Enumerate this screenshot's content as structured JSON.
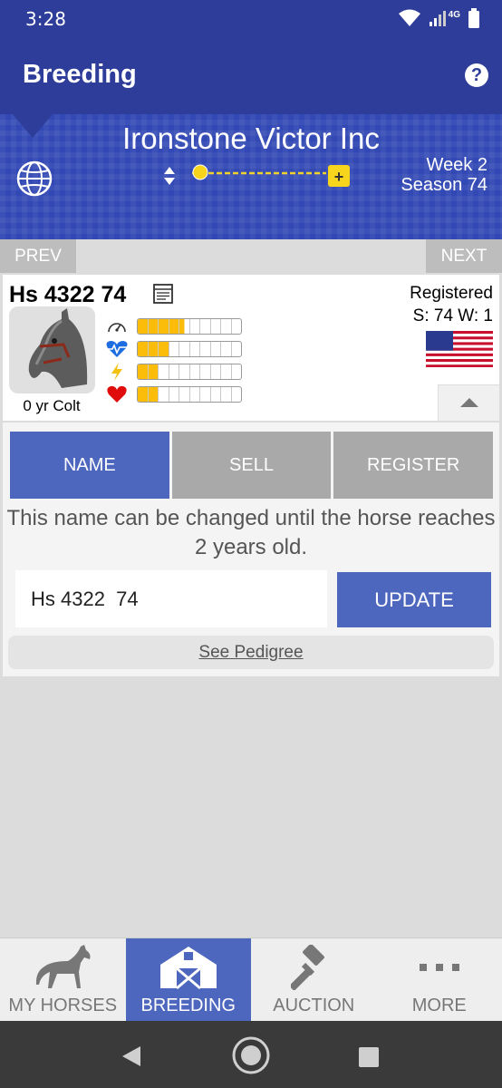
{
  "status_bar": {
    "time": "3:28",
    "network": "4G",
    "icons": [
      "wifi-icon",
      "signal-icon",
      "battery-icon"
    ]
  },
  "app_bar": {
    "title": "Breeding",
    "help_icon": "help-icon",
    "help_glyph": "?"
  },
  "banner": {
    "stable_name": "Ironstone Victor Inc",
    "week": "Week 2",
    "season": "Season 74",
    "season_progress": 0.05,
    "icons": [
      "globe-icon",
      "up-down-arrows-icon",
      "plus-icon"
    ]
  },
  "nav": {
    "prev": "PREV",
    "next": "NEXT"
  },
  "horse": {
    "name": "Hs 4322  74",
    "age": "0 yr Colt",
    "registration": "Registered",
    "stats_line": "S: 74 W: 1",
    "flag": "us-flag-icon",
    "stat_bars": [
      {
        "icon": "speedometer-icon",
        "level": 0.45
      },
      {
        "icon": "heartbeat-icon",
        "level": 0.3
      },
      {
        "icon": "lightning-icon",
        "level": 0.2
      },
      {
        "icon": "heart-icon",
        "level": 0.2
      }
    ]
  },
  "panel": {
    "tabs": [
      "NAME",
      "SELL",
      "REGISTER"
    ],
    "active_tab": "NAME",
    "info": "This name can be changed until the horse reaches 2 years old.",
    "name_value": "Hs 4322  74",
    "update_label": "UPDATE",
    "pedigree_label": "See Pedigree"
  },
  "bottom_nav": {
    "items": [
      {
        "label": "MY HORSES",
        "icon": "horse-icon"
      },
      {
        "label": "BREEDING",
        "icon": "barn-icon"
      },
      {
        "label": "AUCTION",
        "icon": "gavel-icon"
      },
      {
        "label": "MORE",
        "icon": "more-icon"
      }
    ],
    "active": "BREEDING"
  },
  "colors": {
    "primary": "#2d3d99",
    "accent": "#4e67be",
    "stat_fill": "#fbbd0a",
    "inactive_tab": "#a9a9a9"
  }
}
